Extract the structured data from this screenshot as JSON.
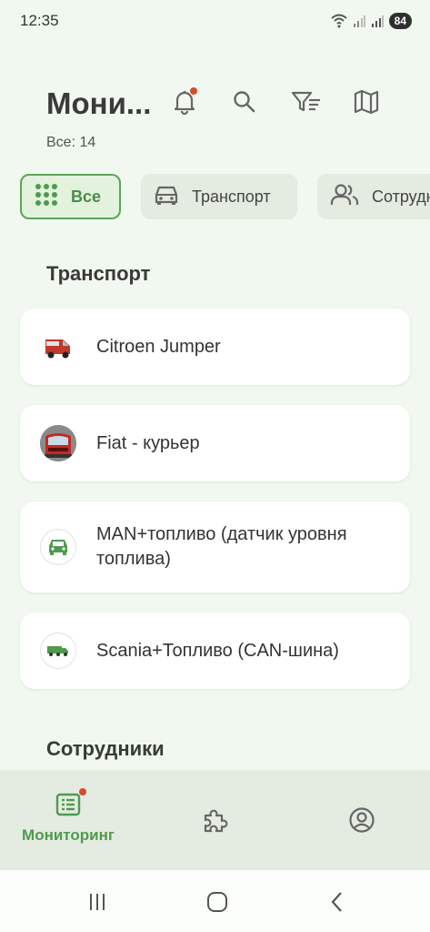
{
  "status_bar": {
    "time": "12:35",
    "battery": "84",
    "icons": [
      "wifi-icon",
      "signal-icon",
      "signal-icon",
      "battery-icon"
    ]
  },
  "header": {
    "title": "Мони...",
    "count_text": "Все: 14",
    "actions": [
      "bell-icon",
      "search-icon",
      "filter-icon",
      "map-icon"
    ]
  },
  "filters": [
    {
      "label": "Все",
      "icon": "grid-icon",
      "selected": true
    },
    {
      "label": "Транспорт",
      "icon": "car-icon",
      "selected": false
    },
    {
      "label": "Сотрудн",
      "icon": "people-icon",
      "selected": false
    }
  ],
  "sections": {
    "transport_title": "Транспорт",
    "staff_title": "Сотрудники"
  },
  "transport_items": [
    {
      "label": "Citroen Jumper",
      "icon": "van-image"
    },
    {
      "label": "Fiat - курьер",
      "icon": "truck-cab-image"
    },
    {
      "label": "MAN+топливо (датчик уровня топлива)",
      "icon": "car-icon"
    },
    {
      "label": "Scania+Топливо (CAN-шина)",
      "icon": "truck-icon"
    }
  ],
  "bottom_nav": {
    "items": [
      {
        "label": "Мониторинг",
        "icon": "list-icon",
        "active": true
      },
      {
        "label": "",
        "icon": "puzzle-icon",
        "active": false
      },
      {
        "label": "",
        "icon": "account-icon",
        "active": false
      }
    ]
  },
  "colors": {
    "background": "#f1f8ef",
    "accent": "#4f9a4c",
    "notification": "#d84a2f",
    "chip_bg": "#e4ebe1"
  }
}
